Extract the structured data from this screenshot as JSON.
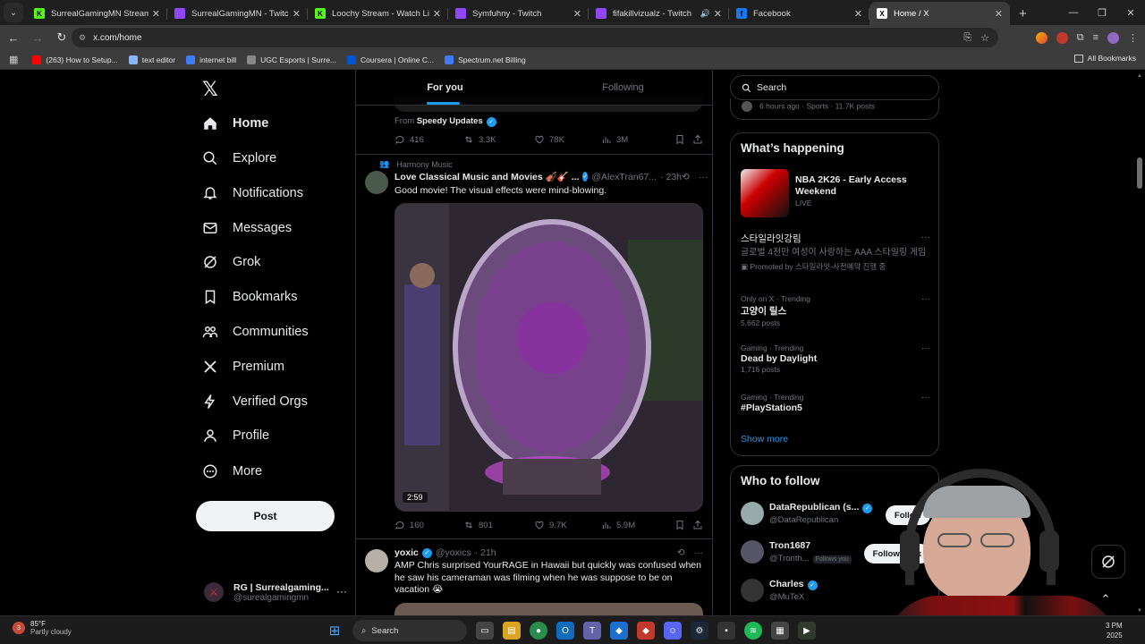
{
  "browser": {
    "tabs": [
      {
        "title": "SurrealGamingMN Stream - Wa",
        "favicon_color": "#53fc18",
        "favicon_letter": "K",
        "active": false
      },
      {
        "title": "SurrealGamingMN - Twitch",
        "favicon_color": "#9146ff",
        "favicon_letter": "",
        "active": false
      },
      {
        "title": "Loochy Stream - Watch Live on",
        "favicon_color": "#53fc18",
        "favicon_letter": "K",
        "active": false
      },
      {
        "title": "Symfuhny - Twitch",
        "favicon_color": "#9146ff",
        "favicon_letter": "",
        "active": false
      },
      {
        "title": "fifakillvizualz - Twitch",
        "favicon_color": "#9146ff",
        "favicon_letter": "",
        "active": false,
        "audio": true
      },
      {
        "title": "Facebook",
        "favicon_color": "#1877f2",
        "favicon_letter": "f",
        "active": false
      },
      {
        "title": "Home / X",
        "favicon_color": "#ffffff",
        "favicon_letter": "X",
        "active": true
      }
    ],
    "url": "x.com/home",
    "bookmarks": [
      {
        "label": "(263) How to Setup...",
        "color": "#ff0000"
      },
      {
        "label": "text editor",
        "color": "#8ab4f8"
      },
      {
        "label": "internet bill",
        "color": "#3d7cf5"
      },
      {
        "label": "UGC Esports | Surre...",
        "color": "#888888"
      },
      {
        "label": "Coursera | Online C...",
        "color": "#0056d2"
      },
      {
        "label": "Spectrum.net Billing",
        "color": "#3d7cf5"
      }
    ],
    "all_bookmarks": "All Bookmarks"
  },
  "nav": {
    "items": [
      {
        "label": "Home",
        "icon": "home-icon",
        "bold": true
      },
      {
        "label": "Explore",
        "icon": "search-icon"
      },
      {
        "label": "Notifications",
        "icon": "bell-icon"
      },
      {
        "label": "Messages",
        "icon": "envelope-icon"
      },
      {
        "label": "Grok",
        "icon": "grok-icon"
      },
      {
        "label": "Bookmarks",
        "icon": "bookmark-icon"
      },
      {
        "label": "Communities",
        "icon": "people-icon"
      },
      {
        "label": "Premium",
        "icon": "x-icon"
      },
      {
        "label": "Verified Orgs",
        "icon": "lightning-icon"
      },
      {
        "label": "Profile",
        "icon": "person-icon"
      },
      {
        "label": "More",
        "icon": "more-circle-icon"
      }
    ],
    "post_label": "Post",
    "account": {
      "name": "RG | Surrealgaming...",
      "handle": "@surealgamingmn"
    }
  },
  "feed": {
    "tabs": [
      "For you",
      "Following"
    ],
    "prev_tweet": {
      "from_label": "From",
      "from_name": "Speedy Updates",
      "replies": "416",
      "reposts": "3.3K",
      "likes": "78K",
      "views": "3M"
    },
    "tweet1": {
      "social_context": "Harmony Music",
      "name": "Love Classical Music and Movies 🎻🎸 ...",
      "handle": "@AlexTran67...",
      "time": "· 23h",
      "text": "Good movie! The visual effects were mind-blowing.",
      "duration": "2:59",
      "replies": "160",
      "reposts": "801",
      "likes": "9.7K",
      "views": "5.9M"
    },
    "tweet2": {
      "name": "yoxic",
      "handle": "@yoxics",
      "time": "· 21h",
      "text": "AMP Chris surprised YourRAGE in Hawaii but quickly was confused when he saw his cameraman was filming when he was suppose to be on vacation 😭"
    }
  },
  "sidebar": {
    "search_placeholder": "Search",
    "prev_trend_meta": "6 hours ago · Sports · 11.7K posts",
    "happening_title": "What’s happening",
    "feature": {
      "title": "NBA 2K26 - Early Access Weekend",
      "status": "LIVE"
    },
    "promo": {
      "title": "스타일라잇강림",
      "desc": "글로벌 4천만 여성이 사랑하는 AAA 스타일링 게임",
      "promoted": "Promoted by 스타일라잇-사전예약 진행 중"
    },
    "trends": [
      {
        "meta": "Only on X · Trending",
        "title": "고양이 릴스",
        "posts": "5,662 posts"
      },
      {
        "meta": "Gaming · Trending",
        "title": "Dead by Daylight",
        "posts": "1,716 posts"
      },
      {
        "meta": "Gaming · Trending",
        "title": "#PlayStation5",
        "posts": ""
      }
    ],
    "show_more": "Show more",
    "wtf_title": "Who to follow",
    "follow": [
      {
        "name": "DataRepublican (s...",
        "handle": "@DataRepublican",
        "verified": true,
        "button": "Follow",
        "follows_you": ""
      },
      {
        "name": "Tron1687",
        "handle": "@Tronth...",
        "verified": false,
        "button": "Follow back",
        "follows_you": "Follows you"
      },
      {
        "name": "Charles",
        "handle": "@MuTeX",
        "verified": true,
        "button": "",
        "follows_you": ""
      }
    ]
  },
  "taskbar": {
    "badge": "3",
    "temp": "85°F",
    "condition": "Partly cloudy",
    "search": "Search",
    "clock_time": "3 PM",
    "clock_date": "2025"
  }
}
